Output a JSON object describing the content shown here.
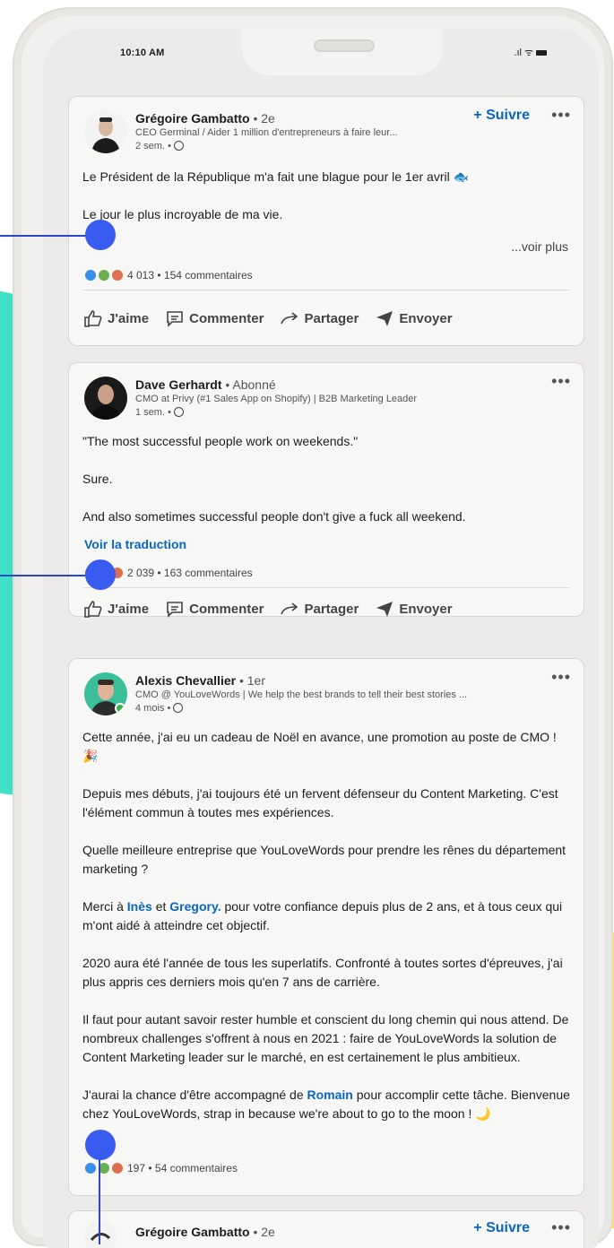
{
  "status_bar": {
    "time": "10:10 AM",
    "signal": ".ıl",
    "wifi": "ᯤ"
  },
  "posts": [
    {
      "author": "Grégoire Gambatto",
      "degree": "• 2e",
      "headline": "CEO Germinal / Aider 1 million d'entrepreneurs à faire leur...",
      "time": "2 sem. •",
      "follow_label": "+ Suivre",
      "more": "•••",
      "paragraphs": [
        "Le Président de la République m'a fait une blague pour le 1er avril 🐟",
        "Le jour le plus incroyable de ma vie."
      ],
      "see_more": "...voir plus",
      "reaction_count": "4 013",
      "comments": "• 154 commentaires",
      "actions": {
        "like": "J'aime",
        "comment": "Commenter",
        "share": "Partager",
        "send": "Envoyer"
      }
    },
    {
      "author": "Dave Gerhardt",
      "degree": "• Abonné",
      "headline": "CMO at Privy (#1 Sales App on Shopify) | B2B Marketing Leader",
      "time": "1 sem. •",
      "more": "•••",
      "paragraphs": [
        "\"The most successful people work on weekends.\"",
        "Sure.",
        "And also sometimes successful people don't give a fuck all weekend."
      ],
      "translate": "Voir la traduction",
      "reaction_count": "2 039",
      "comments": "• 163 commentaires",
      "actions": {
        "like": "J'aime",
        "comment": "Commenter",
        "share": "Partager",
        "send": "Envoyer"
      }
    },
    {
      "author": "Alexis Chevallier",
      "degree": "• 1er",
      "headline": "CMO @ YouLoveWords | We help the best brands to tell their best stories ...",
      "time": "4 mois •",
      "more": "•••",
      "p1": "Cette année, j'ai eu un cadeau de Noël en avance, une promotion au poste de CMO ! 🎉",
      "p2": "Depuis mes débuts, j'ai toujours été un fervent défenseur du Content Marketing. C'est l'élément commun à toutes mes expériences.",
      "p3": "Quelle meilleure entreprise que YouLoveWords pour prendre les rênes du département marketing ?",
      "p4_a": "Merci à ",
      "p4_link1": "Inès",
      "p4_b": " et ",
      "p4_link2": "Gregory.",
      "p4_c": " pour votre confiance depuis plus de 2 ans, et à tous ceux qui m'ont aidé à atteindre cet objectif.",
      "p5": "2020 aura été l'année de tous les superlatifs. Confronté à toutes sortes d'épreuves, j'ai plus appris ces derniers mois qu'en 7 ans de carrière.",
      "p6": "Il faut pour autant savoir rester humble et conscient du long chemin qui nous attend. De nombreux challenges s'offrent à nous en 2021 : faire de YouLoveWords la solution de Content Marketing leader sur le marché, en est certainement le plus ambitieux.",
      "p7_a": "J'aurai la chance d'être accompagné de ",
      "p7_link": "Romain",
      "p7_b": " pour accomplir cette tâche. Bienvenue chez YouLoveWords, strap in because we're about to go to the moon ! 🌙",
      "reaction_count": "197",
      "comments": "• 54 commentaires"
    },
    {
      "author": "Grégoire Gambatto",
      "degree": "• 2e",
      "follow_label": "+ Suivre",
      "more": "•••"
    }
  ],
  "colors": {
    "accent": "#0a66c2",
    "pin": "#3a5bf0",
    "teal": "#3fe0c6",
    "yellow": "#fde24a"
  }
}
